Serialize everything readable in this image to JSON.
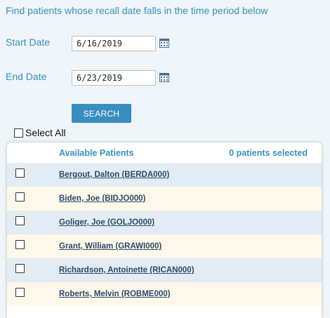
{
  "instructions": "Find patients whose recall date falls in the time period below",
  "start_date": {
    "label": "Start Date",
    "value": "6/16/2019"
  },
  "end_date": {
    "label": "End Date",
    "value": "6/23/2019"
  },
  "search_label": "SEARCH",
  "select_all_label": "Select All",
  "panel": {
    "title": "Available Patients",
    "selected_count": "0 patients selected"
  },
  "patients": [
    {
      "name": "Bergout, Dalton (BERDA000)"
    },
    {
      "name": "Biden, Joe (BIDJO000)"
    },
    {
      "name": "Goliger, Joe (GOLJO000)"
    },
    {
      "name": "Grant, William (GRAWI000)"
    },
    {
      "name": "Richardson, Antoinette (RICAN000)"
    },
    {
      "name": "Roberts, Melvin (ROBME000)"
    }
  ],
  "colors": {
    "accent": "#3a90b8",
    "button": "#3a8dc0",
    "row_blue": "#e3ecf2",
    "row_cream": "#fdf8ea"
  },
  "icons": {
    "calendar": "calendar-icon"
  }
}
